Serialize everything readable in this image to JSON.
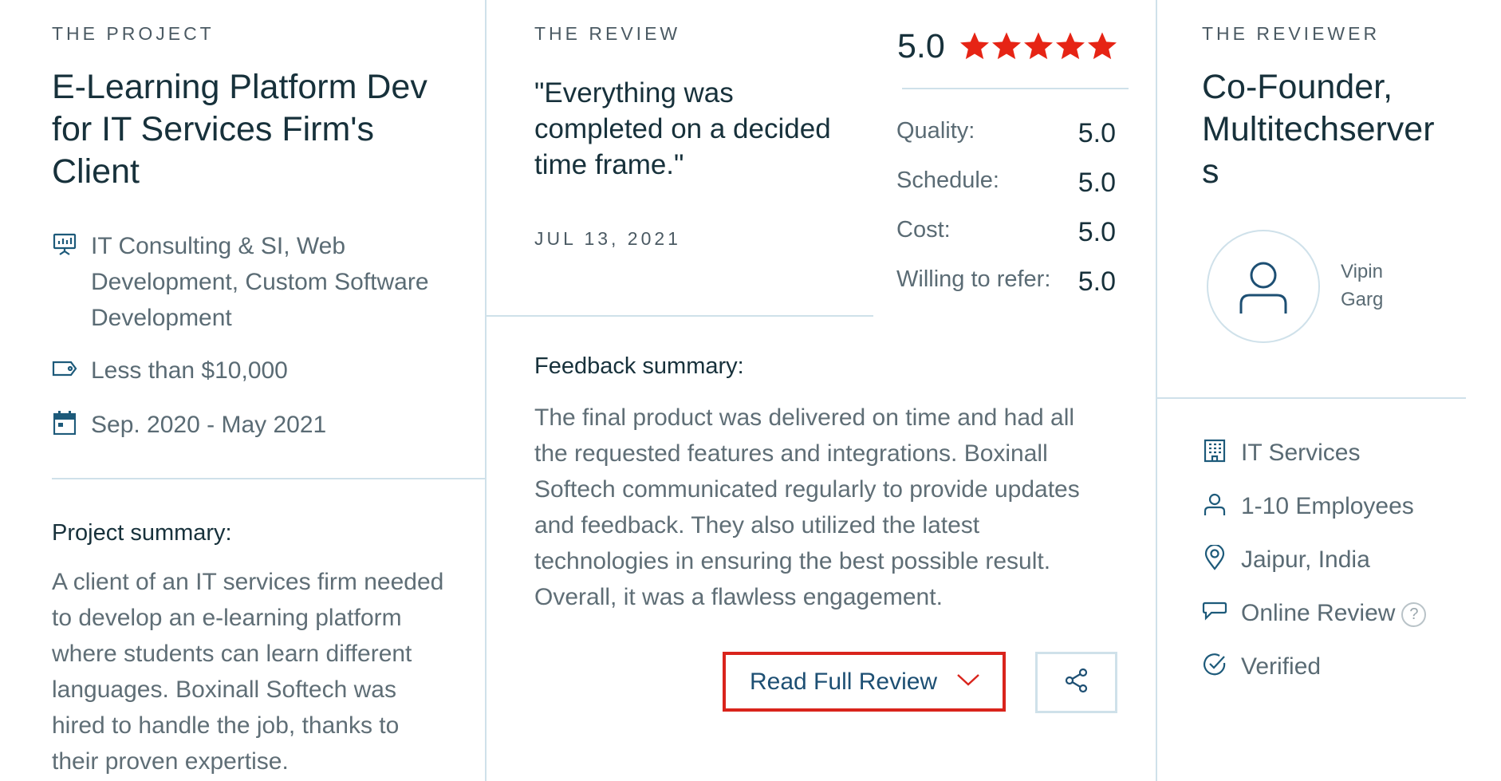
{
  "project": {
    "eyebrow": "THE PROJECT",
    "title_lines": [
      "E-Learning Platform Dev",
      "for IT Services Firm's",
      "Client"
    ],
    "services_lines": [
      "IT Consulting & SI, Web",
      "Development, Custom Software",
      "Development"
    ],
    "budget": "Less than $10,000",
    "dates": "Sep. 2020 - May 2021",
    "summary_heading": "Project summary:",
    "summary_lines": [
      "A client of an IT services firm needed",
      "to develop an e-learning platform",
      "where students can learn different",
      "languages. Boxinall Softech was",
      "hired to handle the job, thanks to",
      "their proven expertise."
    ],
    "icons": {
      "services": "presentation-icon",
      "budget": "price-tag-icon",
      "dates": "calendar-icon"
    }
  },
  "review": {
    "eyebrow": "THE REVIEW",
    "quote_lines": [
      "\"Everything was",
      "completed on a decided",
      "time frame.\""
    ],
    "date": "JUL 13, 2021",
    "overall_score": "5.0",
    "stars": 5,
    "star_color": "#e62415",
    "ratings": [
      {
        "label": "Quality:",
        "value": "5.0"
      },
      {
        "label": "Schedule:",
        "value": "5.0"
      },
      {
        "label": "Cost:",
        "value": "5.0"
      },
      {
        "label": "Willing to refer:",
        "value": "5.0"
      }
    ],
    "feedback_heading": "Feedback summary:",
    "feedback_lines": [
      "The final product was delivered on time and had all",
      "the requested features and integrations. Boxinall",
      "Softech communicated regularly to provide updates",
      "and feedback. They also utilized the latest",
      "technologies in ensuring the best possible result.",
      "Overall, it was a flawless engagement."
    ],
    "read_full_label": "Read Full Review",
    "read_full_border": "#d9241c",
    "share_icon": "share-icon"
  },
  "reviewer": {
    "eyebrow": "THE REVIEWER",
    "title_lines": [
      "Co-Founder,",
      "Multitechserver",
      "s"
    ],
    "name_first": "Vipin",
    "name_last": "Garg",
    "details": [
      {
        "icon": "building-icon",
        "text": "IT Services"
      },
      {
        "icon": "person-icon",
        "text": "1-10 Employees"
      },
      {
        "icon": "location-pin-icon",
        "text": "Jaipur, India"
      },
      {
        "icon": "chat-bubble-icon",
        "text": "Online Review"
      },
      {
        "icon": "check-circle-icon",
        "text": "Verified"
      }
    ],
    "help_glyph": "?"
  }
}
